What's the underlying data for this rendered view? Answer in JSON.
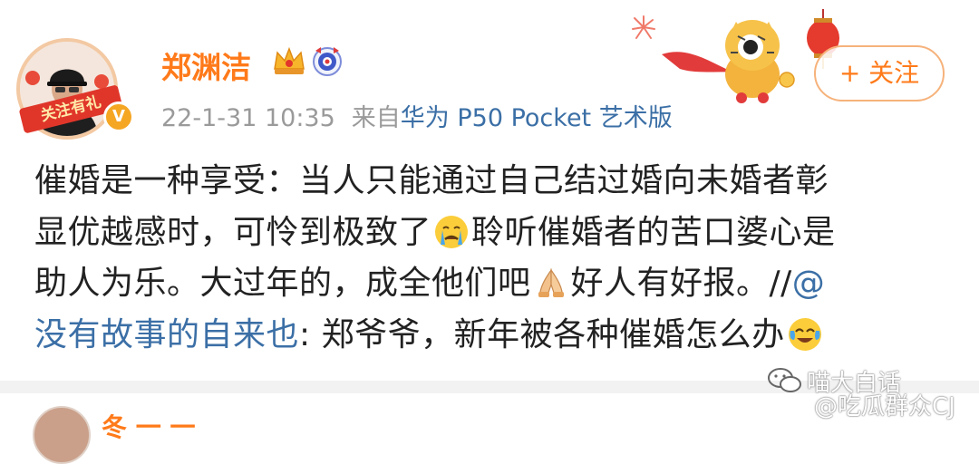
{
  "user": {
    "name": "郑渊洁",
    "avatar_banner": "关注有礼",
    "verified_badge": "V",
    "crown_icon": "crown-icon",
    "vip_icon": "vip-badge-icon"
  },
  "meta": {
    "time": "22-1-31 10:35",
    "source_prefix": "来自",
    "device": "华为 P50 Pocket 艺术版"
  },
  "follow_button": {
    "label": "+ 关注"
  },
  "post": {
    "line1": "催婚是一种享受：当人只能通过自己结过婚向未婚者彰",
    "line2a": "显优越感时，可怜到极致了",
    "line2b": "聆听催婚者的苦口婆心是",
    "line3a": "助人为乐。大过年的，成全他们吧",
    "line3b": "好人有好报。//",
    "mention_start": "@",
    "mention": "没有故事的自来也",
    "line4": ": 郑爷爷，新年被各种催婚怎么办",
    "emojis": [
      "crying-face-icon",
      "praying-hands-icon",
      "tears-of-joy-icon"
    ]
  },
  "next_user": {
    "name": "冬 一 一"
  },
  "watermark": {
    "line1": "喵大白话",
    "line2": "@吃瓜群众CJ"
  },
  "colors": {
    "accent": "#ff7a1a",
    "link": "#3b6fa6",
    "meta": "#9a9a9a"
  }
}
